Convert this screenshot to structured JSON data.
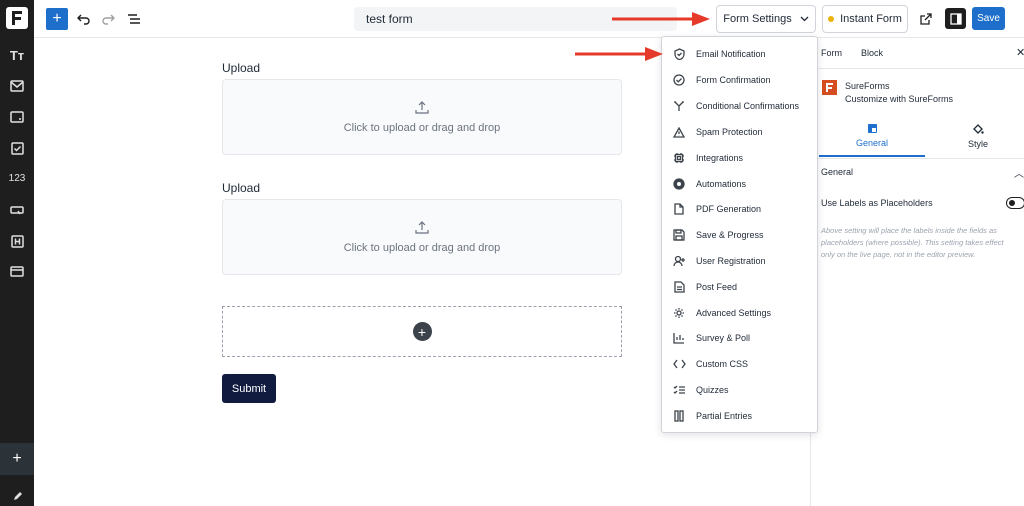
{
  "toolbar": {
    "form_title": "test form",
    "form_settings_label": "Form Settings",
    "instant_form_label": "Instant Form",
    "save_label": "Save"
  },
  "sidebar": {
    "icons": [
      "logo-icon",
      "text-icon",
      "mail-icon",
      "input-icon",
      "checkbox-icon",
      "number-icon",
      "button-icon",
      "heading-icon",
      "card-icon",
      "plus-icon",
      "pencil-icon"
    ],
    "number_label": "123",
    "text_label": "Tт",
    "add_label": "+"
  },
  "form": {
    "fields": [
      {
        "label": "Upload",
        "prompt": "Click to upload or drag and drop"
      },
      {
        "label": "Upload",
        "prompt": "Click to upload or drag and drop"
      }
    ],
    "submit_label": "Submit"
  },
  "menu": {
    "items": [
      {
        "label": "Email Notification",
        "icon": "shield-icon"
      },
      {
        "label": "Form Confirmation",
        "icon": "check-circle-icon"
      },
      {
        "label": "Conditional Confirmations",
        "icon": "branch-icon"
      },
      {
        "label": "Spam Protection",
        "icon": "warning-icon"
      },
      {
        "label": "Integrations",
        "icon": "chip-icon"
      },
      {
        "label": "Automations",
        "icon": "automation-icon"
      },
      {
        "label": "PDF Generation",
        "icon": "document-icon"
      },
      {
        "label": "Save & Progress",
        "icon": "save-icon"
      },
      {
        "label": "User Registration",
        "icon": "user-plus-icon"
      },
      {
        "label": "Post Feed",
        "icon": "post-icon"
      },
      {
        "label": "Advanced Settings",
        "icon": "gear-icon"
      },
      {
        "label": "Survey & Poll",
        "icon": "bar-chart-icon"
      },
      {
        "label": "Custom CSS",
        "icon": "code-icon"
      },
      {
        "label": "Quizzes",
        "icon": "quiz-icon"
      },
      {
        "label": "Partial Entries",
        "icon": "partial-icon"
      }
    ]
  },
  "panel": {
    "tabs": [
      "Form",
      "Block"
    ],
    "brand_name": "SureForms",
    "brand_sub": "Customize with SureForms",
    "sub_tabs": [
      "General",
      "Style"
    ],
    "section_title": "General",
    "option_label": "Use Labels as Placeholders",
    "help_lines": [
      "Above setting will place the labels inside the fields as",
      "placeholders (where possible). This setting takes effect",
      "only on the live page, not in the editor preview."
    ]
  },
  "colors": {
    "accent": "#1e6fcc",
    "submit": "#111b3f",
    "arrow": "#e53a2a",
    "brand": "#d54e21"
  }
}
